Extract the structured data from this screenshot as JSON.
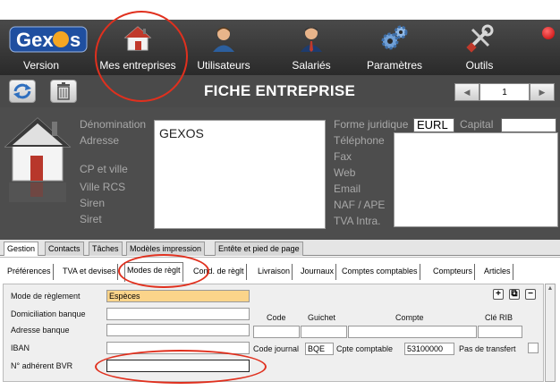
{
  "app": {
    "logo_text": "Gexos",
    "nav": [
      {
        "label": "Version",
        "icon": "gexos-logo"
      },
      {
        "label": "Mes entreprises",
        "icon": "house-icon"
      },
      {
        "label": "Utilisateurs",
        "icon": "user-icon"
      },
      {
        "label": "Salariés",
        "icon": "employee-icon"
      },
      {
        "label": "Paramètres",
        "icon": "gears-icon"
      },
      {
        "label": "Outils",
        "icon": "tools-icon"
      }
    ]
  },
  "titlebar": {
    "title": "FICHE ENTREPRISE",
    "page_number": "1",
    "prev_icon": "prev-arrow-icon",
    "next_icon": "next-arrow-icon"
  },
  "company": {
    "labels": {
      "denomination": "Dénomination",
      "adresse": "Adresse",
      "cp_ville": "CP et ville",
      "ville_rcs": "Ville RCS",
      "siren": "Siren",
      "siret": "Siret",
      "forme_juridique": "Forme juridique",
      "capital": "Capital",
      "telephone": "Téléphone",
      "fax": "Fax",
      "web": "Web",
      "email": "Email",
      "naf": "NAF / APE",
      "tva": "TVA Intra."
    },
    "denomination_value": "GEXOS",
    "forme_juridique_value": "EURL",
    "capital_value": ""
  },
  "tabs_primary": [
    "Gestion",
    "Contacts",
    "Tâches",
    "Modèles impression",
    "Entête et pied de page"
  ],
  "tabs_secondary": [
    "Préférences",
    "TVA et devises",
    "Modes de règlt",
    "Cond. de règlt",
    "Livraison",
    "Journaux",
    "Comptes comptables",
    "Compteurs",
    "Articles"
  ],
  "form": {
    "mode_reglement_label": "Mode de règlement",
    "mode_reglement_value": "Espèces",
    "domiciliation_label": "Domiciliation banque",
    "adresse_banque_label": "Adresse banque",
    "iban_label": "IBAN",
    "bvr_label": "N° adhérent BVR",
    "col_code": "Code",
    "col_guichet": "Guichet",
    "col_compte": "Compte",
    "col_cle_rib": "Clé RIB",
    "code_journal_label": "Code journal",
    "code_journal_value": "BQE",
    "cpte_comptable_label": "Cpte comptable",
    "cpte_comptable_value": "53100000",
    "pas_transfert_label": "Pas de transfert",
    "btn_add": "+",
    "btn_copy": "⧉",
    "btn_remove": "−"
  },
  "colors": {
    "nav_bg": "#333333",
    "card_bg": "#4d4d4d",
    "highlight_field": "#fbd48a",
    "annotation_ring": "#e0301e"
  }
}
